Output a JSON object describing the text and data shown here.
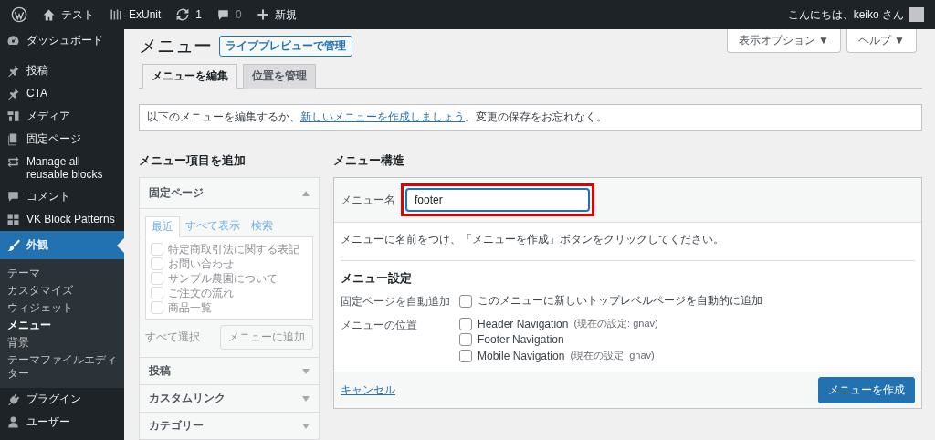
{
  "admin_bar": {
    "items": [
      {
        "kind": "wp-logo"
      },
      {
        "kind": "home",
        "label": "テスト"
      },
      {
        "kind": "plugin",
        "label": "ExUnit"
      },
      {
        "kind": "updates",
        "label": "1"
      },
      {
        "kind": "comments",
        "label": "0"
      },
      {
        "kind": "new",
        "label": "新規"
      }
    ],
    "greeting": "こんにちは、keiko さん"
  },
  "sidebar": {
    "items": [
      {
        "label": "ダッシュボード",
        "selected": false
      },
      {
        "label": "投稿",
        "selected": false
      },
      {
        "label": "CTA",
        "selected": false
      },
      {
        "label": "メディア",
        "selected": false
      },
      {
        "label": "固定ページ",
        "selected": false
      },
      {
        "label": "Manage all reusable blocks",
        "selected": false
      },
      {
        "label": "コメント",
        "selected": false
      },
      {
        "label": "VK Block Patterns",
        "selected": false
      },
      {
        "label": "外観",
        "selected": true,
        "children": [
          {
            "label": "テーマ",
            "selected": false
          },
          {
            "label": "カスタマイズ",
            "selected": false
          },
          {
            "label": "ウィジェット",
            "selected": false
          },
          {
            "label": "メニュー",
            "selected": true
          },
          {
            "label": "背景",
            "selected": false
          },
          {
            "label": "テーマファイルエディター",
            "selected": false
          }
        ]
      },
      {
        "label": "プラグイン",
        "selected": false
      },
      {
        "label": "ユーザー",
        "selected": false
      }
    ]
  },
  "header": {
    "title": "メニュー",
    "live_preview_button": "ライブプレビューで管理",
    "screen_options": "表示オプション ▼",
    "help": "ヘルプ ▼"
  },
  "tabs": [
    {
      "label": "メニューを編集",
      "selected": true
    },
    {
      "label": "位置を管理",
      "selected": false
    }
  ],
  "notice": {
    "text_before": "以下のメニューを編集するか、",
    "link": "新しいメニューを作成しましょう",
    "text_after": "。変更の保存をお忘れなく。"
  },
  "add_items": {
    "heading": "メニュー項目を追加",
    "disabled": true,
    "sections": [
      {
        "title": "固定ページ",
        "expanded": true,
        "tabs": [
          {
            "label": "最近",
            "selected": true
          },
          {
            "label": "すべて表示",
            "selected": false
          },
          {
            "label": "検索",
            "selected": false
          }
        ],
        "items": [
          {
            "label": "特定商取引法に関する表記",
            "checked": false
          },
          {
            "label": "お問い合わせ",
            "checked": false
          },
          {
            "label": "サンプル農園について",
            "checked": false
          },
          {
            "label": "ご注文の流れ",
            "checked": false
          },
          {
            "label": "商品一覧",
            "checked": false
          }
        ],
        "select_all": "すべて選択",
        "add_button": "メニューに追加"
      },
      {
        "title": "投稿",
        "expanded": false
      },
      {
        "title": "カスタムリンク",
        "expanded": false
      },
      {
        "title": "カテゴリー",
        "expanded": false
      }
    ]
  },
  "structure": {
    "heading": "メニュー構造",
    "name_label": "メニュー名",
    "name_value": "footer",
    "name_highlighted": true,
    "instructions": "メニューに名前をつけ、「メニューを作成」ボタンをクリックしてください。",
    "settings_heading": "メニュー設定",
    "auto_add": {
      "label": "固定ページを自動追加",
      "option": "このメニューに新しいトップレベルページを自動的に追加",
      "checked": false
    },
    "locations": {
      "label": "メニューの位置",
      "items": [
        {
          "label": "Header Navigation",
          "note": "(現在の設定: gnav)",
          "checked": false
        },
        {
          "label": "Footer Navigation",
          "checked": false
        },
        {
          "label": "Mobile Navigation",
          "note": "(現在の設定: gnav)",
          "checked": false
        }
      ]
    },
    "cancel": "キャンセル",
    "create_button": "メニューを作成"
  }
}
